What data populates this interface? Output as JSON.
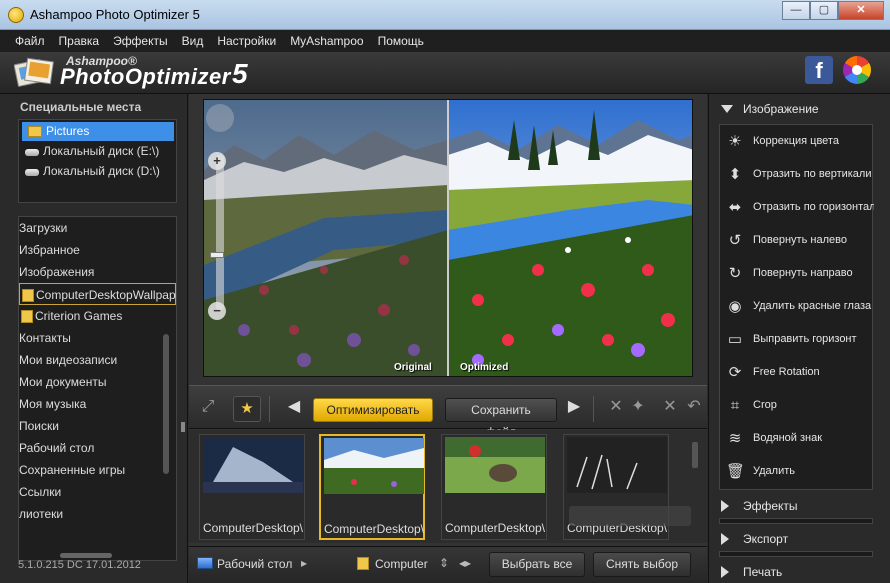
{
  "window": {
    "title": "Ashampoo Photo Optimizer 5",
    "minimize": "—",
    "maximize": "▢",
    "close": "✕"
  },
  "menu": [
    "Файл",
    "Правка",
    "Эффекты",
    "Вид",
    "Настройки",
    "MyAshampoo",
    "Помощь"
  ],
  "header": {
    "brand_small": "Ashampoo®",
    "brand_big": "PhotoOptimizer",
    "brand_version": "5",
    "facebook_letter": "f"
  },
  "left": {
    "places_title": "Специальные места",
    "places": [
      {
        "label": "Pictures",
        "icon": "folder-icon",
        "selected": true
      },
      {
        "label": "Локальный диск (E:\\)",
        "icon": "disk-icon"
      },
      {
        "label": "Локальный диск (D:\\)",
        "icon": "disk-icon"
      }
    ],
    "tree": [
      {
        "label": "Загрузки"
      },
      {
        "label": "Избранное"
      },
      {
        "label": "Изображения"
      },
      {
        "label": "ComputerDesktopWallpape",
        "folder": true,
        "highlight": true
      },
      {
        "label": "Criterion Games",
        "folder": true
      },
      {
        "label": "Контакты"
      },
      {
        "label": "Мои видеозаписи"
      },
      {
        "label": "Мои документы"
      },
      {
        "label": "Моя музыка"
      },
      {
        "label": "Поиски"
      },
      {
        "label": "Рабочий стол"
      },
      {
        "label": "Сохраненные игры"
      },
      {
        "label": "Ссылки"
      },
      {
        "label": "лиотеки"
      }
    ],
    "version": "5.1.0.215 DC 17.01.2012"
  },
  "preview": {
    "label_original": "Original",
    "label_optimized": "Optimized"
  },
  "toolbar": {
    "optimize": "Оптимизировать",
    "save": "Сохранить файл",
    "star": "★"
  },
  "thumbnails": [
    {
      "label": "ComputerDesktop\\",
      "selected": false
    },
    {
      "label": "ComputerDesktop\\",
      "selected": true
    },
    {
      "label": "ComputerDesktop\\",
      "selected": false
    },
    {
      "label": "ComputerDesktop\\",
      "selected": false
    }
  ],
  "bottombar": {
    "desktop": "Рабочий стол",
    "folder": "Computer",
    "select_all": "Выбрать все",
    "deselect": "Снять выбор"
  },
  "right": {
    "section_image": "Изображение",
    "items": [
      {
        "label": "Коррекция цвета",
        "icon": "sun-icon"
      },
      {
        "label": "Отразить по вертикали",
        "icon": "flip-vertical-icon"
      },
      {
        "label": "Отразить по горизонтали",
        "icon": "flip-horizontal-icon"
      },
      {
        "label": "Повернуть налево",
        "icon": "rotate-left-icon"
      },
      {
        "label": "Повернуть направо",
        "icon": "rotate-right-icon"
      },
      {
        "label": "Удалить красные глаза",
        "icon": "eye-icon"
      },
      {
        "label": "Выправить горизонт",
        "icon": "horizon-icon"
      },
      {
        "label": "Free Rotation",
        "icon": "free-rotation-icon"
      },
      {
        "label": "Crop",
        "icon": "crop-icon"
      },
      {
        "label": "Водяной знак",
        "icon": "watermark-icon"
      },
      {
        "label": "Удалить",
        "icon": "trash-icon"
      }
    ],
    "section_effects": "Эффекты",
    "section_export": "Экспорт",
    "section_print": "Печать"
  }
}
